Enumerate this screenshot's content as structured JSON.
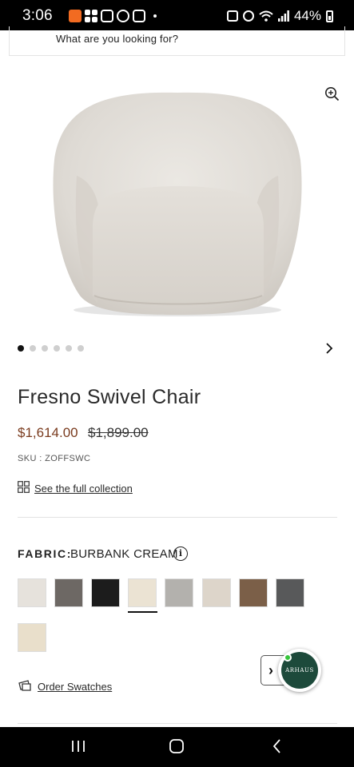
{
  "status_bar": {
    "time": "3:06",
    "battery_percent": "44%",
    "icons": [
      "temu-icon",
      "grid-app-icon",
      "news-icon",
      "shield-app-icon",
      "mail-icon",
      "nfc-icon",
      "alarm-icon",
      "wifi-icon",
      "signal-icon",
      "battery-icon"
    ]
  },
  "search": {
    "placeholder": "What are you looking for?"
  },
  "product": {
    "title": "Fresno Swivel Chair",
    "price": "$1,614.00",
    "original_price": "$1,899.00",
    "sku": "SKU : ZOFFSWC",
    "collection_link": "See the full collection",
    "image_count": 6,
    "active_image": 1
  },
  "fabric": {
    "label": "FABRIC:",
    "selected": "BURBANK CREAM",
    "info_icon": "i",
    "swatches": [
      {
        "color": "#e6e2dc",
        "selected": false
      },
      {
        "color": "#6d6864",
        "selected": false
      },
      {
        "color": "#1c1c1c",
        "selected": false
      },
      {
        "color": "#ebe3d3",
        "selected": true
      },
      {
        "color": "#b3b1ad",
        "selected": false
      },
      {
        "color": "#ddd5ca",
        "selected": false
      },
      {
        "color": "#7b5f48",
        "selected": false
      },
      {
        "color": "#58595a",
        "selected": false
      },
      {
        "color": "#e9dfcb",
        "selected": false
      }
    ]
  },
  "order_swatches": "Order Swatches",
  "chat": {
    "brand": "ARHAUS"
  },
  "colors": {
    "sale_price": "#7a3b1e",
    "brand_green": "#1d4a3b",
    "online": "#36c43a"
  }
}
